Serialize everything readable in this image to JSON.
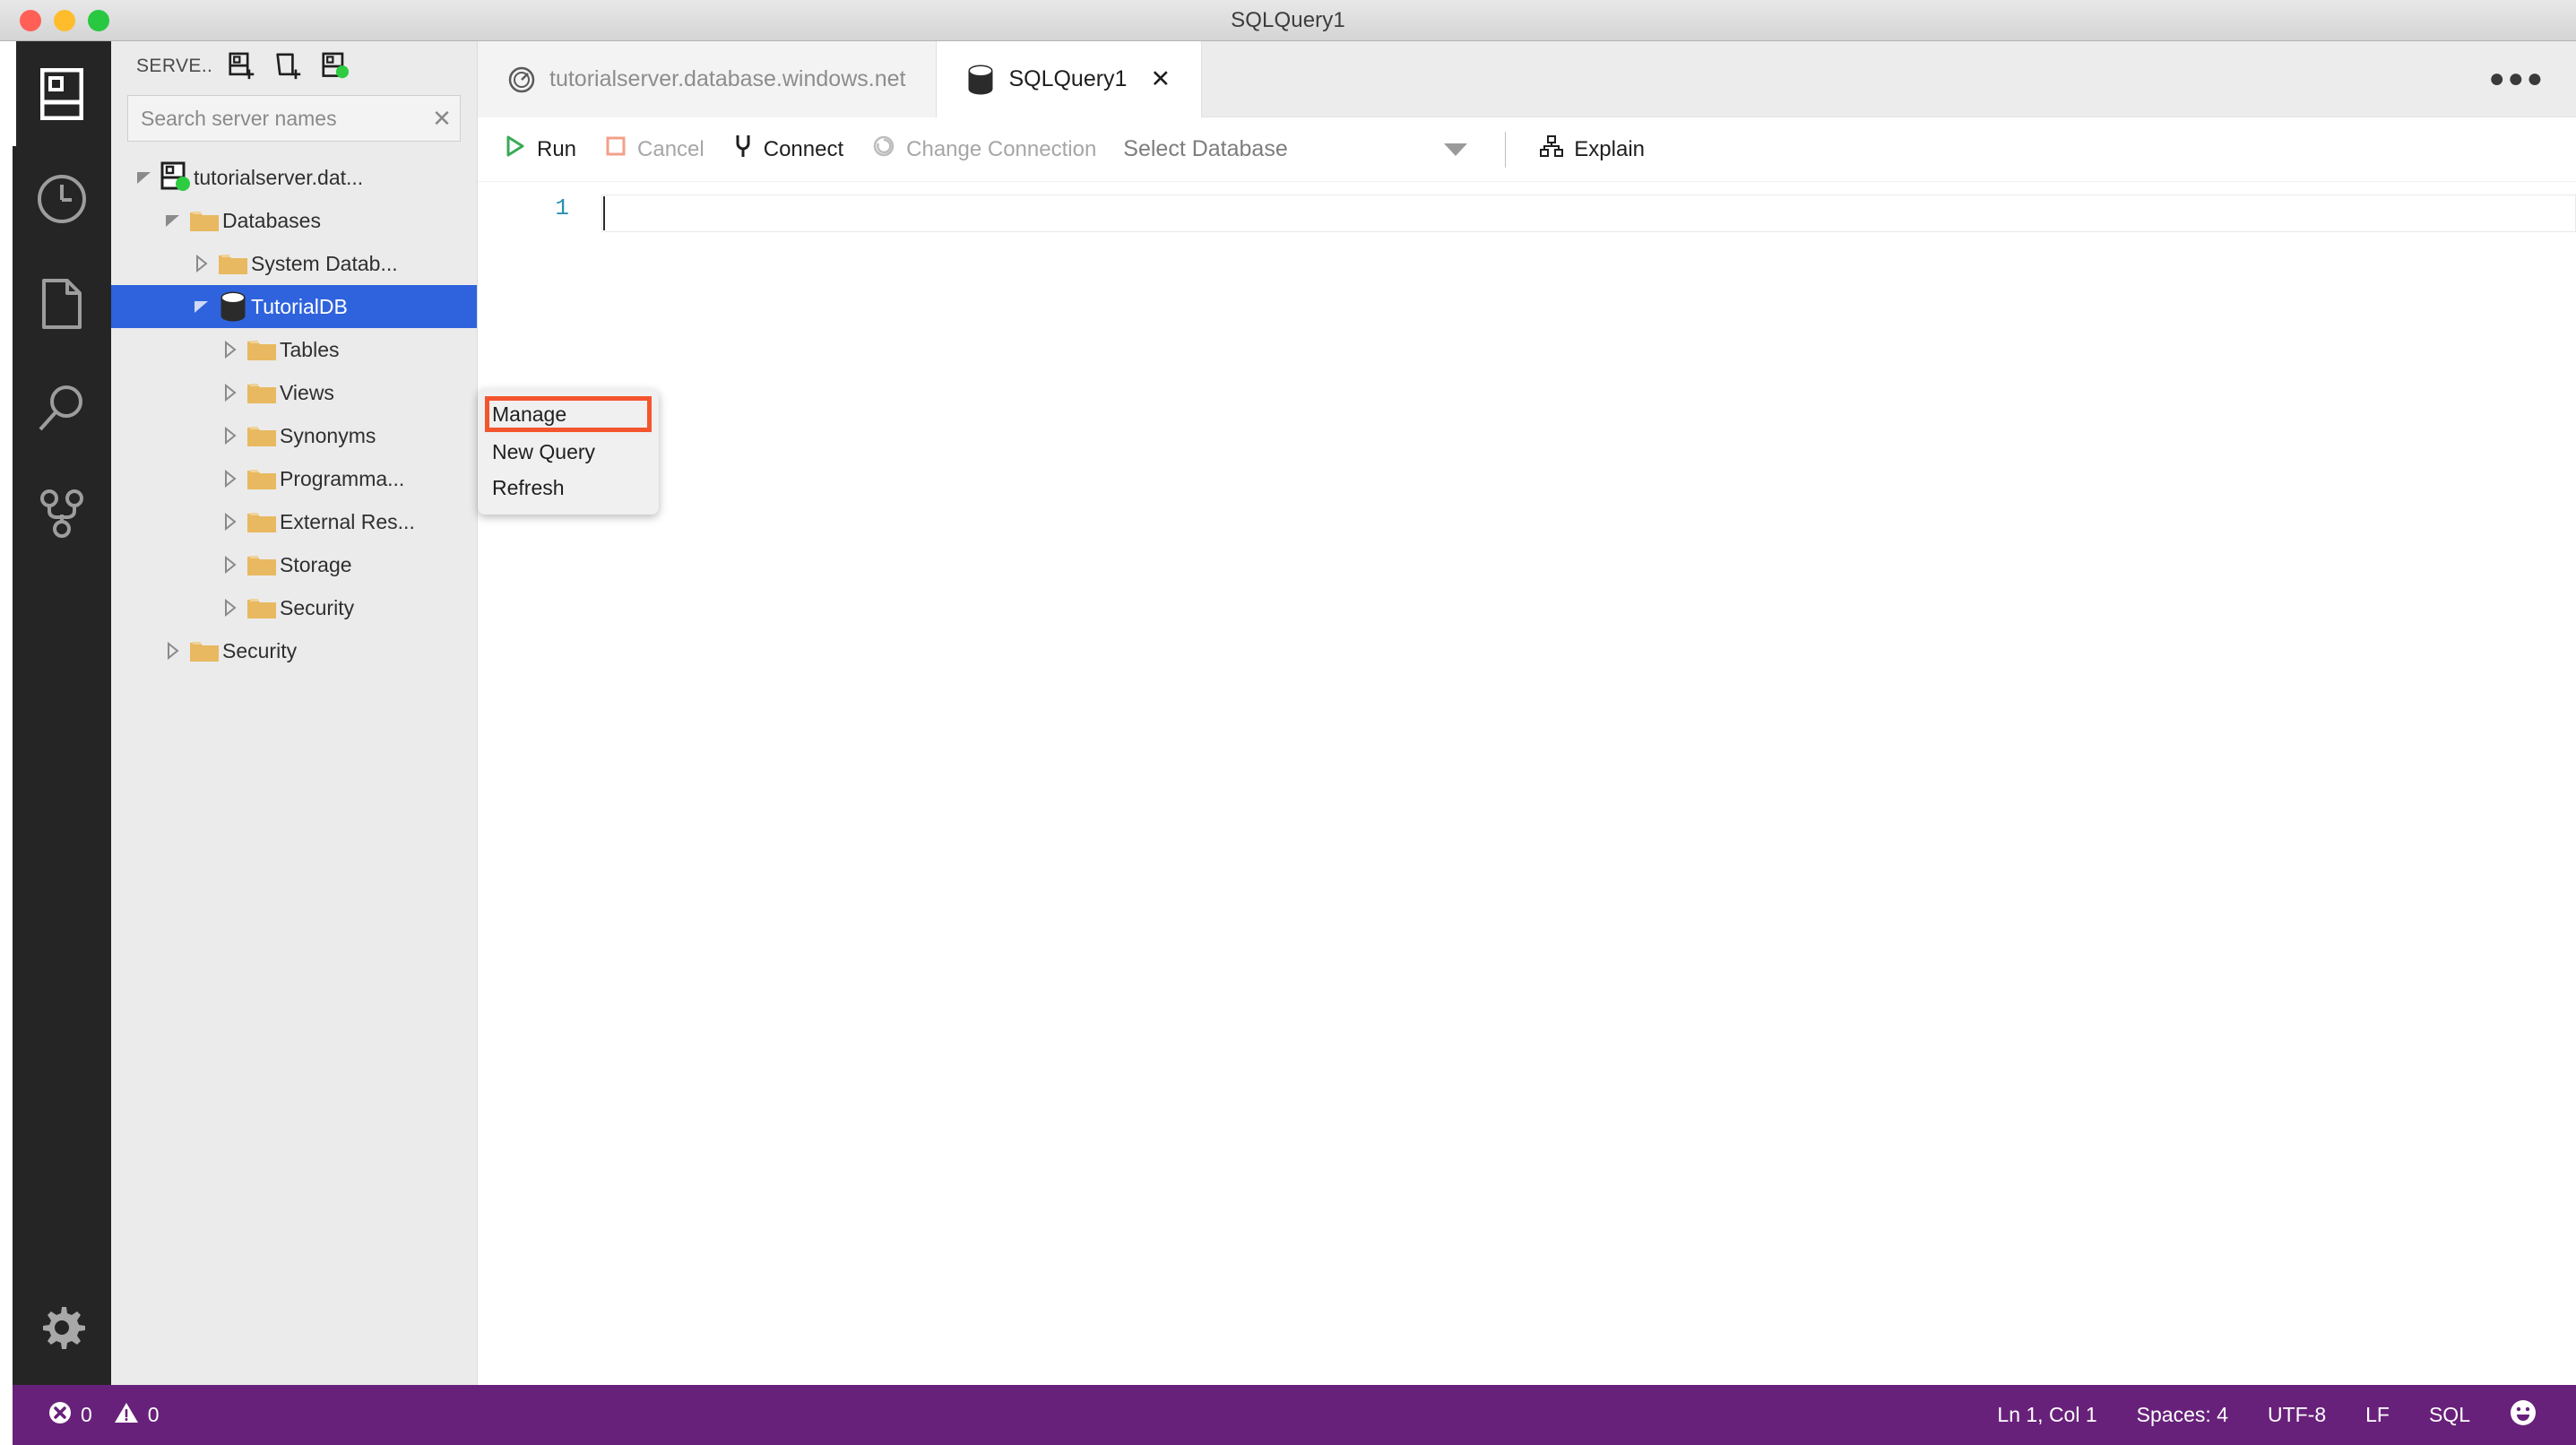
{
  "window": {
    "title": "SQLQuery1",
    "traffic_lights": [
      "close",
      "minimize",
      "maximize"
    ]
  },
  "activity_bar": {
    "items": [
      {
        "name": "servers",
        "icon": "server-icon",
        "active": true
      },
      {
        "name": "history",
        "icon": "clock-icon",
        "active": false
      },
      {
        "name": "files",
        "icon": "file-icon",
        "active": false
      },
      {
        "name": "search",
        "icon": "search-icon",
        "active": false
      },
      {
        "name": "source-control",
        "icon": "source-control-icon",
        "active": false
      }
    ],
    "bottom": {
      "name": "manage",
      "icon": "gear-icon"
    }
  },
  "servers_panel": {
    "title": "SERVE..",
    "actions": [
      {
        "name": "new-connection",
        "icon": "add-server-icon"
      },
      {
        "name": "new-server-group",
        "icon": "add-folder-icon"
      },
      {
        "name": "connected-server",
        "icon": "server-connected-icon"
      }
    ],
    "search": {
      "placeholder": "Search server names",
      "value": "",
      "clear_label": "✕"
    },
    "tree": [
      {
        "label": "tutorialserver.dat...",
        "depth": 0,
        "icon": "server-connected-icon",
        "twisty": "expanded",
        "selected": false
      },
      {
        "label": "Databases",
        "depth": 1,
        "icon": "folder-icon",
        "twisty": "expanded",
        "selected": false
      },
      {
        "label": "System Datab...",
        "depth": 2,
        "icon": "folder-icon",
        "twisty": "collapsed",
        "selected": false
      },
      {
        "label": "TutorialDB",
        "depth": 2,
        "icon": "database-icon",
        "twisty": "expanded",
        "selected": true
      },
      {
        "label": "Tables",
        "depth": 3,
        "icon": "folder-icon",
        "twisty": "collapsed",
        "selected": false
      },
      {
        "label": "Views",
        "depth": 3,
        "icon": "folder-icon",
        "twisty": "collapsed",
        "selected": false
      },
      {
        "label": "Synonyms",
        "depth": 3,
        "icon": "folder-icon",
        "twisty": "collapsed",
        "selected": false
      },
      {
        "label": "Programma...",
        "depth": 3,
        "icon": "folder-icon",
        "twisty": "collapsed",
        "selected": false
      },
      {
        "label": "External Res...",
        "depth": 3,
        "icon": "folder-icon",
        "twisty": "collapsed",
        "selected": false
      },
      {
        "label": "Storage",
        "depth": 3,
        "icon": "folder-icon",
        "twisty": "collapsed",
        "selected": false
      },
      {
        "label": "Security",
        "depth": 3,
        "icon": "folder-icon",
        "twisty": "collapsed",
        "selected": false
      },
      {
        "label": "Security",
        "depth": 1,
        "icon": "folder-icon",
        "twisty": "collapsed",
        "selected": false
      }
    ]
  },
  "context_menu": {
    "items": [
      {
        "label": "Manage",
        "highlighted": true
      },
      {
        "label": "New Query",
        "highlighted": false
      },
      {
        "label": "Refresh",
        "highlighted": false
      }
    ],
    "highlight_color": "#f4552f"
  },
  "tabs": [
    {
      "label": "tutorialserver.database.windows.net",
      "icon": "dashboard-icon",
      "active": false,
      "closable": false
    },
    {
      "label": "SQLQuery1",
      "icon": "database-icon",
      "active": true,
      "closable": true,
      "close_label": "✕"
    }
  ],
  "tabs_more_label": "●●●",
  "toolbar": {
    "run_label": "Run",
    "cancel_label": "Cancel",
    "connect_label": "Connect",
    "change_connection_label": "Change Connection",
    "database_select_value": "Select Database",
    "explain_label": "Explain"
  },
  "editor": {
    "line_numbers": [
      "1"
    ],
    "content": ""
  },
  "status_bar": {
    "errors": "0",
    "warnings": "0",
    "cursor_position": "Ln 1, Col 1",
    "indentation": "Spaces: 4",
    "encoding": "UTF-8",
    "eol": "LF",
    "language": "SQL",
    "feedback_icon": "smiley-icon",
    "background": "#68217a"
  },
  "colors": {
    "selection_blue": "#2f63dd",
    "folder_yellow": "#e8b960",
    "run_green": "#3aaa58",
    "connected_green": "#2ecc40",
    "line_number": "#2b91af"
  }
}
